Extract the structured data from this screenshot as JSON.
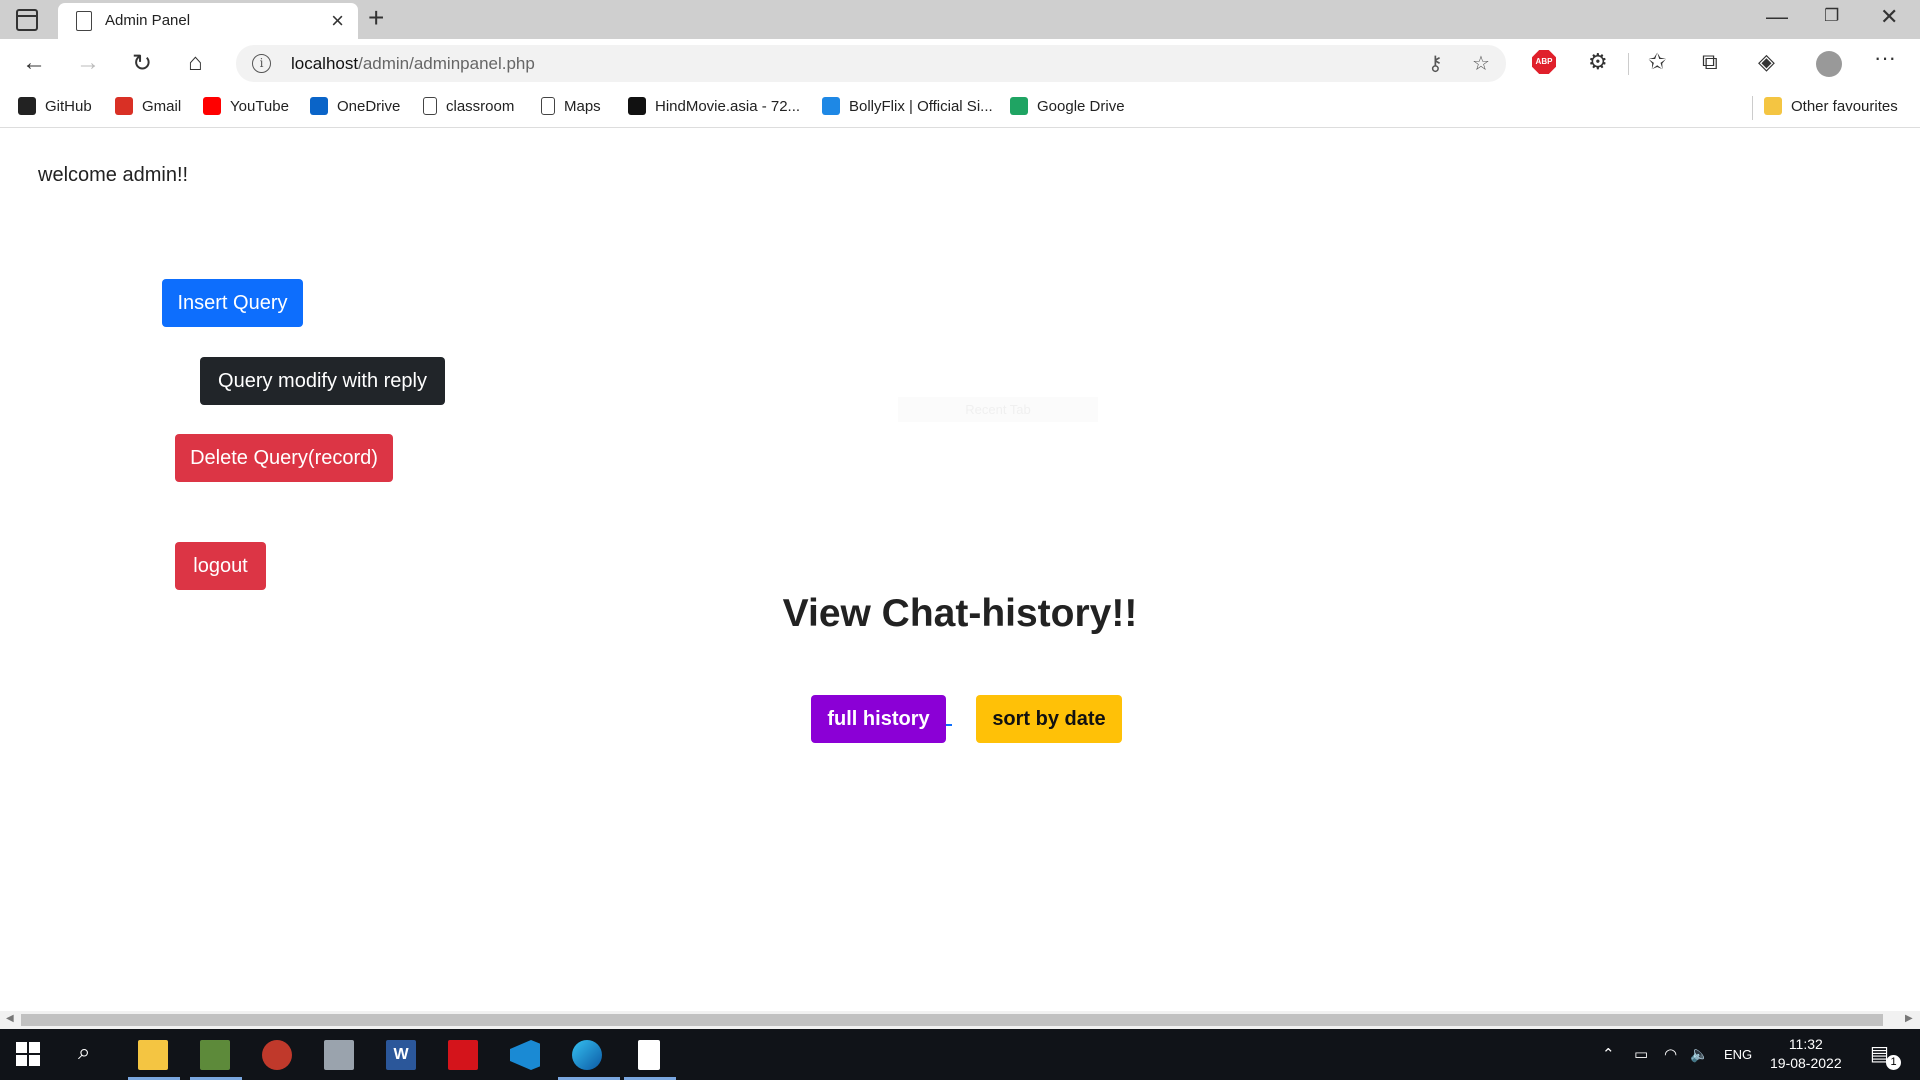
{
  "browser": {
    "tab_title": "Admin Panel",
    "url_host": "localhost",
    "url_path": "/admin/adminpanel.php",
    "bookmarks": [
      {
        "label": "GitHub",
        "icon": "github-icon",
        "color": "#222222"
      },
      {
        "label": "Gmail",
        "icon": "gmail-icon",
        "color": "#d93025"
      },
      {
        "label": "YouTube",
        "icon": "youtube-icon",
        "color": "#ff0000"
      },
      {
        "label": "OneDrive",
        "icon": "onedrive-icon",
        "color": "#0a64c8"
      },
      {
        "label": "classroom",
        "icon": "page-icon",
        "color": "#ffffff"
      },
      {
        "label": "Maps",
        "icon": "page-icon",
        "color": "#ffffff"
      },
      {
        "label": "HindMovie.asia - 72...",
        "icon": "g-icon",
        "color": "#111111"
      },
      {
        "label": "BollyFlix | Official Si...",
        "icon": "bollyflix-icon",
        "color": "#1e88e5"
      },
      {
        "label": "Google Drive",
        "icon": "drive-icon",
        "color": "#1fa463"
      }
    ],
    "other_favourites": "Other favourites"
  },
  "page": {
    "welcome": "welcome admin!!",
    "insert_label": "Insert Query",
    "modify_label": "Query modify with reply",
    "delete_label": "Delete Query(record)",
    "logout_label": "logout",
    "faint_text": "Recent Tab",
    "heading": "View Chat-history!!",
    "full_history_label": "full history",
    "sort_label": "sort by date"
  },
  "colors": {
    "primary": "#0d6efd",
    "dark": "#212529",
    "danger": "#dc3545",
    "purple": "#8b00d6",
    "warning": "#ffc107"
  },
  "taskbar": {
    "lang": "ENG",
    "time": "11:32",
    "date": "19-08-2022",
    "notification_count": "1"
  }
}
